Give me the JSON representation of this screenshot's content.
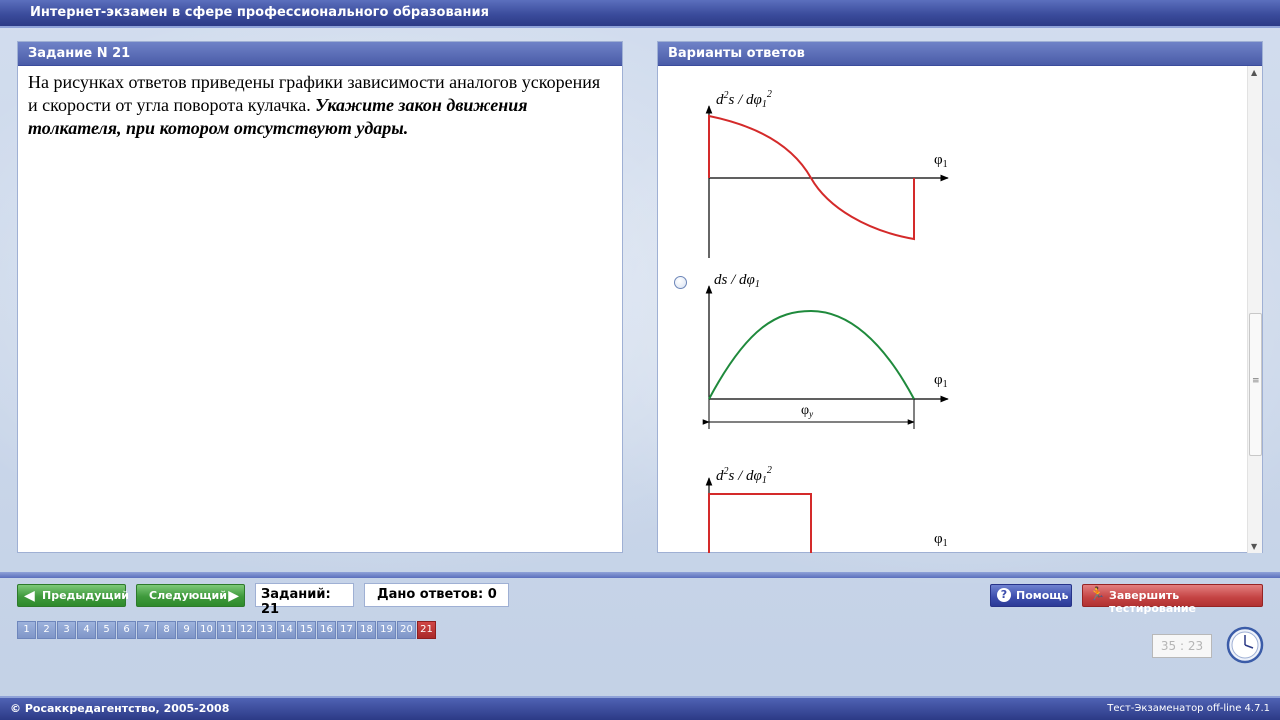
{
  "app": {
    "title": "Интернет-экзамен в сфере профессионального образования"
  },
  "task": {
    "header": "Задание N 21",
    "text_plain": "На рисунках ответов приведены графики зависимости аналогов ускорения и скорости от угла поворота кулачка. ",
    "text_bold": "Укажите закон движения толкателя, при котором отсутствуют удары."
  },
  "answers": {
    "header": "Варианты ответов",
    "option1": {
      "chart1": {
        "ylabel_main": "d",
        "ylabel_sup": "2",
        "ylabel_rest": "s / dφ",
        "ylabel_sub": "1",
        "ylabel_sup2": "2",
        "xlabel": "φ",
        "xlabel_sub": "1"
      },
      "chart2": {
        "ylabel": "ds / dφ",
        "ylabel_sub": "1",
        "xlabel": "φ",
        "xlabel_sub": "1",
        "span_label": "φ",
        "span_sub": "y"
      }
    },
    "option2": {
      "chart1": {
        "ylabel_main": "d",
        "ylabel_sup": "2",
        "ylabel_rest": "s / dφ",
        "ylabel_sub": "1",
        "ylabel_sup2": "2",
        "xlabel": "φ",
        "xlabel_sub": "1"
      }
    }
  },
  "nav": {
    "prev_label": "Предыдущий",
    "next_label": "Следующий",
    "tasks_count": "Заданий: 21",
    "answered_count": "Дано ответов: 0",
    "help_label": "Помощь",
    "finish_label": "Завершить тестирование",
    "pages": [
      "1",
      "2",
      "3",
      "4",
      "5",
      "6",
      "7",
      "8",
      "9",
      "10",
      "11",
      "12",
      "13",
      "14",
      "15",
      "16",
      "17",
      "18",
      "19",
      "20",
      "21"
    ],
    "active_page": "21",
    "timer": "35 : 23"
  },
  "footer": {
    "copyright": "© Росаккредагентство, 2005-2008",
    "version": "Тест-Экзаменатор off-line 4.7.1"
  },
  "colors": {
    "accel_curve": "#d42a2a",
    "velocity_curve": "#1f8a3c",
    "header_blue": "#4a5ca8"
  }
}
